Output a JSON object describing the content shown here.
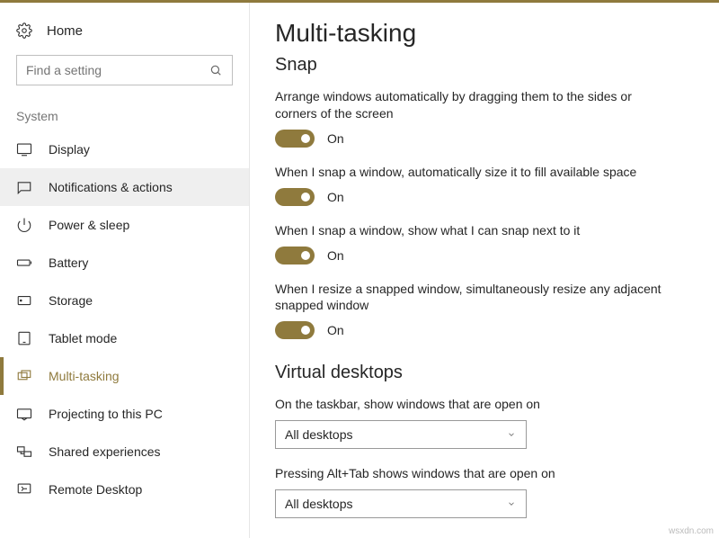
{
  "home_label": "Home",
  "search": {
    "placeholder": "Find a setting"
  },
  "category_label": "System",
  "nav": [
    {
      "name": "display",
      "label": "Display"
    },
    {
      "name": "notifications",
      "label": "Notifications & actions"
    },
    {
      "name": "power",
      "label": "Power & sleep"
    },
    {
      "name": "battery",
      "label": "Battery"
    },
    {
      "name": "storage",
      "label": "Storage"
    },
    {
      "name": "tablet",
      "label": "Tablet mode"
    },
    {
      "name": "multitasking",
      "label": "Multi-tasking"
    },
    {
      "name": "projecting",
      "label": "Projecting to this PC"
    },
    {
      "name": "shared",
      "label": "Shared experiences"
    },
    {
      "name": "remote",
      "label": "Remote Desktop"
    }
  ],
  "page_title": "Multi-tasking",
  "snap": {
    "heading": "Snap",
    "settings": [
      {
        "desc": "Arrange windows automatically by dragging them to the sides or corners of the screen",
        "state": "On"
      },
      {
        "desc": "When I snap a window, automatically size it to fill available space",
        "state": "On"
      },
      {
        "desc": "When I snap a window, show what I can snap next to it",
        "state": "On"
      },
      {
        "desc": "When I resize a snapped window, simultaneously resize any adjacent snapped window",
        "state": "On"
      }
    ]
  },
  "virtual": {
    "heading": "Virtual desktops",
    "taskbar_label": "On the taskbar, show windows that are open on",
    "taskbar_value": "All desktops",
    "alttab_label": "Pressing Alt+Tab shows windows that are open on",
    "alttab_value": "All desktops"
  },
  "watermark": "wsxdn.com"
}
